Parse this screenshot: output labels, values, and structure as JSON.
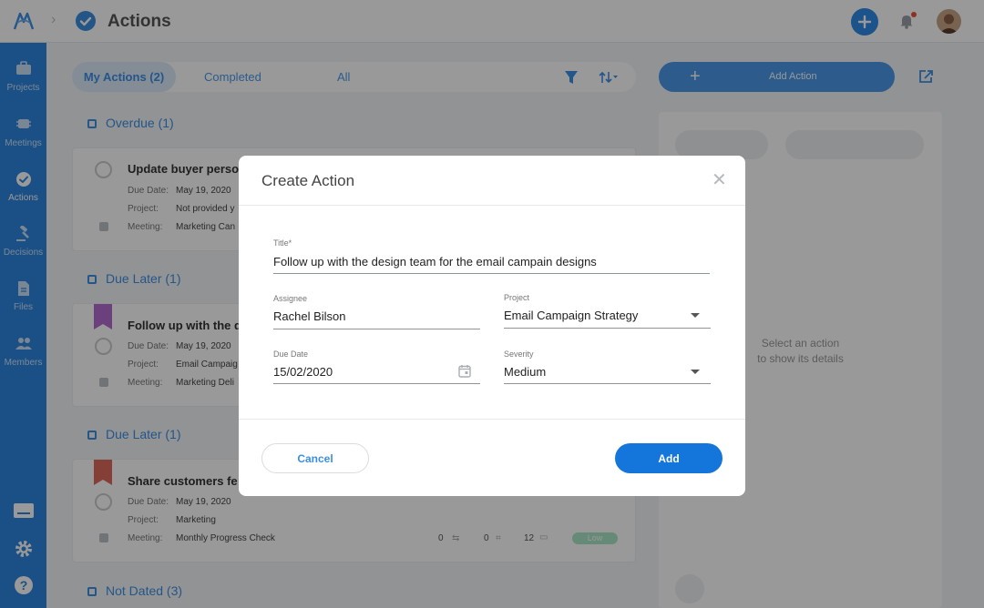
{
  "header": {
    "page_title": "Actions",
    "icons": [
      "logo-icon",
      "chevron-right-icon",
      "check-circle-icon",
      "plus-icon",
      "bell-icon",
      "avatar"
    ]
  },
  "sidebar": {
    "items": [
      {
        "label": "Projects",
        "icon": "briefcase-icon"
      },
      {
        "label": "Meetings",
        "icon": "chip-icon"
      },
      {
        "label": "Actions",
        "icon": "check-circle-icon"
      },
      {
        "label": "Decisions",
        "icon": "gavel-icon"
      },
      {
        "label": "Files",
        "icon": "file-icon"
      },
      {
        "label": "Members",
        "icon": "people-icon"
      }
    ],
    "bottom_icons": [
      "keyboard-icon",
      "gear-icon",
      "help-icon"
    ]
  },
  "tabs": {
    "my_actions": "My Actions (2)",
    "completed": "Completed",
    "all": "All"
  },
  "toolbar": {
    "add_action_label": "Add Action"
  },
  "sections": [
    {
      "header": "Overdue (1)"
    },
    {
      "header": "Due Later (1)"
    },
    {
      "header": "Due Later (1)"
    },
    {
      "header": "Not Dated (3)"
    }
  ],
  "labels": {
    "due_date": "Due Date:",
    "project": "Project:",
    "meeting": "Meeting:"
  },
  "cards": [
    {
      "title": "Update buyer perso",
      "due_date": "May 19, 2020",
      "project": "Not provided y",
      "meeting": "Marketing Can"
    },
    {
      "title": "Follow up with the d",
      "due_date": "May 19, 2020",
      "project": "Email Campaig",
      "meeting": "Marketing Deli",
      "flag_color": "#b56ad0"
    },
    {
      "title": "Share customers fe",
      "due_date": "May 19, 2020",
      "project": "Marketing",
      "meeting": "Monthly Progress Check",
      "flag_color": "#e06a5c",
      "counts": [
        "0",
        "0",
        "12"
      ],
      "severity": "Low"
    }
  ],
  "right_panel": {
    "line1": "Select an action",
    "line2": "to show its details"
  },
  "modal": {
    "title": "Create Action",
    "fields": {
      "title_label": "Title*",
      "title_value": "Follow up with the design team for the email campain designs",
      "assignee_label": "Assignee",
      "assignee_value": "Rachel Bilson",
      "project_label": "Project",
      "project_value": "Email Campaign Strategy",
      "due_date_label": "Due Date",
      "due_date_value": "15/02/2020",
      "severity_label": "Severity",
      "severity_value": "Medium"
    },
    "cancel_label": "Cancel",
    "add_label": "Add"
  },
  "colors": {
    "accent": "#2d86e0",
    "primary_button": "#1476db",
    "badge_low": "#a8e6c6"
  }
}
